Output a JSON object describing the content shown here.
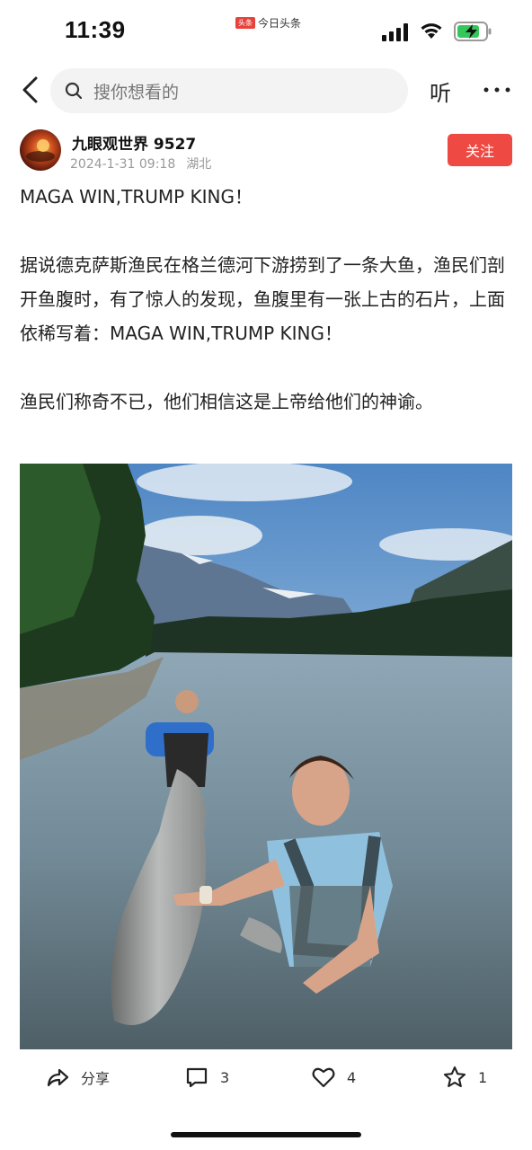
{
  "status_bar": {
    "time": "11:39",
    "app_badge": "头条",
    "app_name": "今日头条"
  },
  "top_nav": {
    "search_placeholder": "搜你想看的",
    "listen_label": "听"
  },
  "author": {
    "name": "九眼观世界 9527",
    "date": "2024-1-31 09:18",
    "location": "湖北",
    "follow_label": "关注"
  },
  "post": {
    "headline": "MAGA WIN,TRUMP KING！",
    "paragraph_1": "据说德克萨斯渔民在格兰德河下游捞到了一条大鱼，渔民们剖开鱼腹时，有了惊人的发现，鱼腹里有一张上古的石片，上面依稀写着：MAGA WIN,TRUMP KING！",
    "paragraph_2": "渔民们称奇不已，他们相信这是上帝给他们的神谕。"
  },
  "actions": {
    "share_label": "分享",
    "comment_count": "3",
    "like_count": "4",
    "favorite_count": "1"
  },
  "colors": {
    "follow": "#ee4a43",
    "search_bg": "#f3f3f3"
  }
}
